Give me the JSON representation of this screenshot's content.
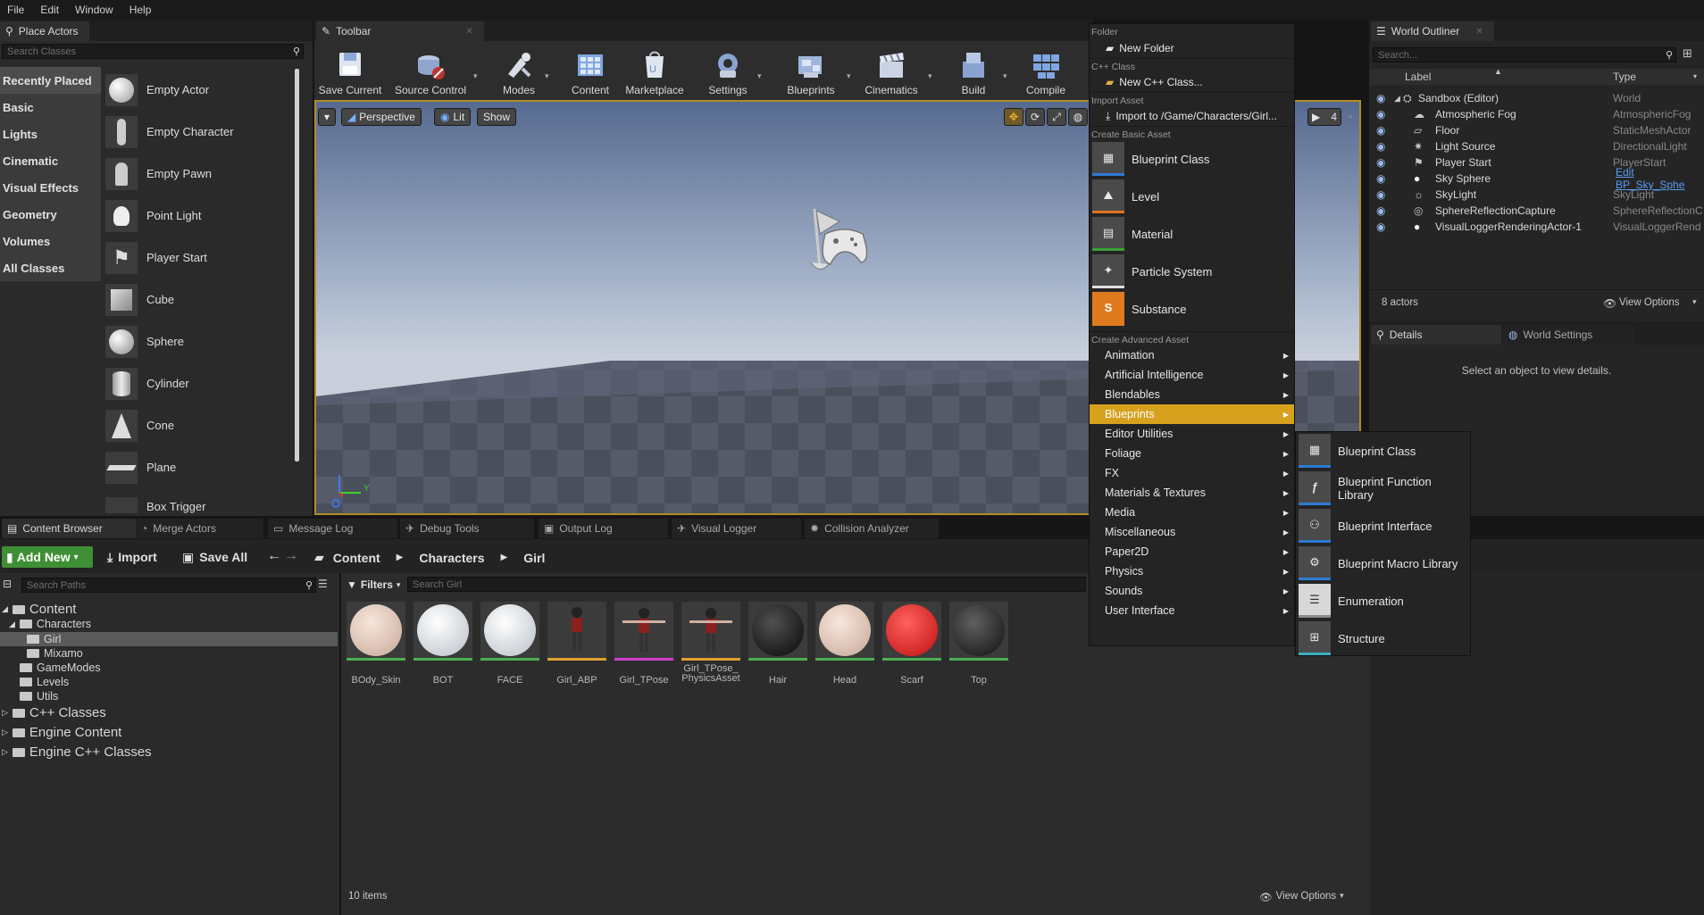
{
  "menubar": [
    "File",
    "Edit",
    "Window",
    "Help"
  ],
  "place_actors": {
    "tab": "Place Actors",
    "search_placeholder": "Search Classes",
    "categories": [
      "Recently Placed",
      "Basic",
      "Lights",
      "Cinematic",
      "Visual Effects",
      "Geometry",
      "Volumes",
      "All Classes"
    ],
    "items": [
      "Empty Actor",
      "Empty Character",
      "Empty Pawn",
      "Point Light",
      "Player Start",
      "Cube",
      "Sphere",
      "Cylinder",
      "Cone",
      "Plane",
      "Box Trigger"
    ]
  },
  "toolbar": {
    "tab": "Toolbar",
    "buttons": [
      "Save Current",
      "Source Control",
      "Modes",
      "Content",
      "Marketplace",
      "Settings",
      "Blueprints",
      "Cinematics",
      "Build",
      "Compile"
    ]
  },
  "viewport": {
    "perspective": "Perspective",
    "lit": "Lit",
    "show": "Show",
    "cam_speed": "4",
    "axis_y": "Y"
  },
  "context_menu": {
    "folder_header": "Folder",
    "new_folder": "New Folder",
    "cpp_header": "C++ Class",
    "new_cpp": "New C++ Class...",
    "import_header": "Import Asset",
    "import_to": "Import to /Game/Characters/Girl...",
    "basic_header": "Create Basic Asset",
    "basic": [
      "Blueprint Class",
      "Level",
      "Material",
      "Particle System",
      "Substance"
    ],
    "advanced_header": "Create Advanced Asset",
    "advanced": [
      "Animation",
      "Artificial Intelligence",
      "Blendables",
      "Blueprints",
      "Editor Utilities",
      "Foliage",
      "FX",
      "Materials & Textures",
      "Media",
      "Miscellaneous",
      "Paper2D",
      "Physics",
      "Sounds",
      "User Interface"
    ],
    "selected": "Blueprints",
    "highlight_color": "#d7a01d"
  },
  "submenu": [
    "Blueprint Class",
    "Blueprint Function Library",
    "Blueprint Interface",
    "Blueprint Macro Library",
    "Enumeration",
    "Structure"
  ],
  "outliner": {
    "tab": "World Outliner",
    "search_placeholder": "Search...",
    "col_label": "Label",
    "col_type": "Type",
    "rows": [
      {
        "label": "Sandbox (Editor)",
        "type": "World"
      },
      {
        "label": "Atmospheric Fog",
        "type": "AtmosphericFog"
      },
      {
        "label": "Floor",
        "type": "StaticMeshActor"
      },
      {
        "label": "Light Source",
        "type": "DirectionalLight"
      },
      {
        "label": "Player Start",
        "type": "PlayerStart"
      },
      {
        "label": "Sky Sphere",
        "type": "Edit BP_Sky_Sphe"
      },
      {
        "label": "SkyLight",
        "type": "SkyLight"
      },
      {
        "label": "SphereReflectionCapture",
        "type": "SphereReflectionC"
      },
      {
        "label": "VisualLoggerRenderingActor-1",
        "type": "VisualLoggerRend"
      }
    ],
    "count": "8 actors",
    "view_options": "View Options"
  },
  "details": {
    "tab_details": "Details",
    "tab_world": "World Settings",
    "empty": "Select an object to view details."
  },
  "bottom_tabs": [
    "Content Browser",
    "Merge Actors",
    "Message Log",
    "Debug Tools",
    "Output Log",
    "Visual Logger",
    "Collision Analyzer"
  ],
  "content_browser": {
    "add_new": "Add New",
    "import": "Import",
    "save_all": "Save All",
    "breadcrumb": [
      "Content",
      "Characters",
      "Girl"
    ],
    "search_paths": "Search Paths",
    "filters": "Filters",
    "search_assets": "Search Girl",
    "tree": [
      "Content",
      "Characters",
      "Girl",
      "Mixamo",
      "GameModes",
      "Levels",
      "Utils",
      "C++ Classes",
      "Engine Content",
      "Engine C++ Classes"
    ],
    "assets": [
      "BOdy_Skin",
      "BOT",
      "FACE",
      "Girl_ABP",
      "Girl_TPose",
      "Girl_TPose_\nPhysicsAsset",
      "Hair",
      "Head",
      "Scarf",
      "Top"
    ],
    "item_count": "10 items",
    "view_options": "View Options"
  }
}
